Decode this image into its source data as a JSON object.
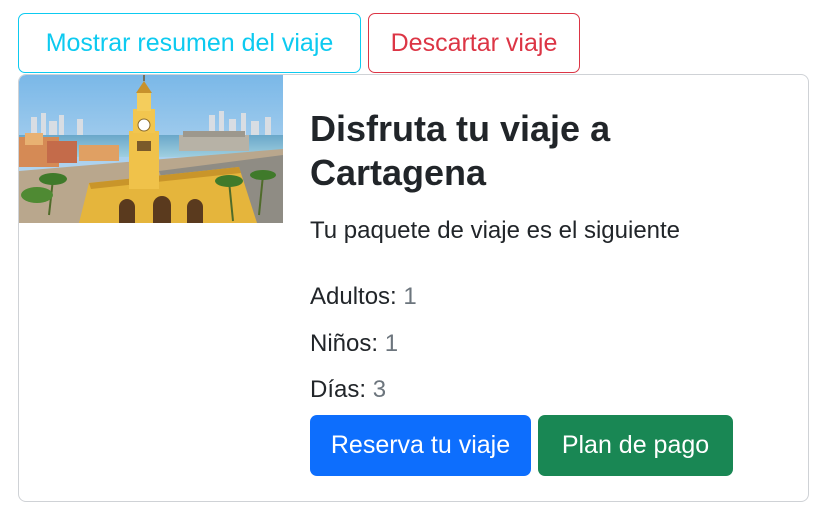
{
  "toolbar": {
    "summary_label": "Mostrar resumen del viaje",
    "discard_label": "Descartar viaje"
  },
  "card": {
    "title": "Disfruta tu viaje a Cartagena",
    "subtitle": "Tu paquete de viaje es el siguiente",
    "details": {
      "adults_label": "Adultos:",
      "adults_value": "1",
      "kids_label": "Niños:",
      "kids_value": "1",
      "days_label": "Días:",
      "days_value": "3"
    },
    "actions": {
      "book_label": "Reserva tu viaje",
      "plan_label": "Plan de pago"
    }
  },
  "colors": {
    "info": "#0dcaf0",
    "danger": "#dc3545",
    "primary": "#0d6efd",
    "success": "#198754",
    "muted": "#6c757d"
  }
}
